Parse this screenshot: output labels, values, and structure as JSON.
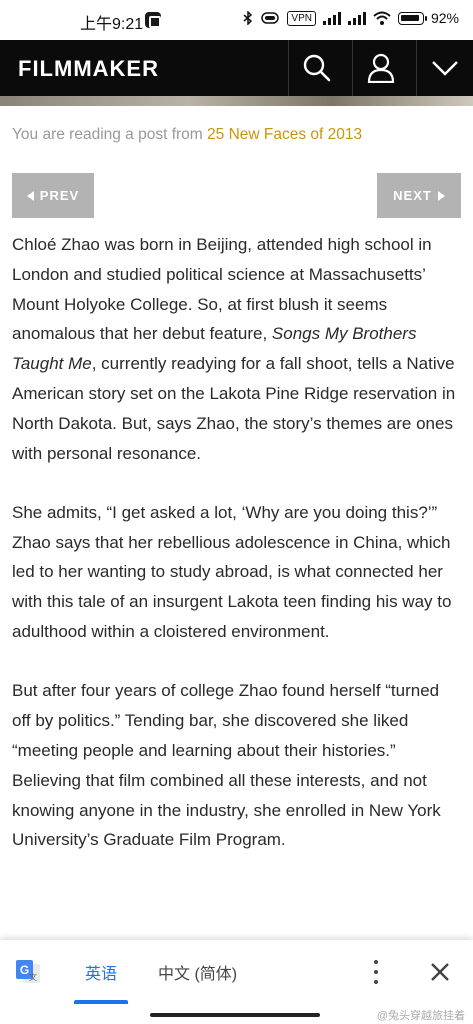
{
  "status_bar": {
    "time": "上午9:21",
    "vpn": "VPN",
    "battery": "92%"
  },
  "header": {
    "logo": "FILMMAKER",
    "icons": [
      "search-icon",
      "user-icon",
      "chevron-down-icon"
    ],
    "background": "#0b0b0b"
  },
  "breadcrumb": {
    "prefix": "You are reading a post from",
    "link": "25 New Faces of 2013",
    "link_color": "#c8950e"
  },
  "pagination": {
    "prev": "PREV",
    "next": "NEXT"
  },
  "article": {
    "p1_a": "Chloé Zhao was born in Beijing, attended high school in London and studied political science at Massachusetts’ Mount Holyoke College. So, at first blush it seems anomalous that her debut feature, ",
    "p1_title": "Songs My Brothers Taught Me",
    "p1_b": ", currently readying for a fall shoot, tells a Native American story set on the Lakota Pine Ridge reservation in North Dakota. But, says Zhao, the story’s themes are ones with personal resonance.",
    "p2": "She admits, “I get asked a lot, ‘Why are you doing this?’” Zhao says that her rebellious adolescence in China, which led to her wanting to study abroad, is what connected her with this tale of an insurgent Lakota teen finding his way to adulthood within a cloistered environment.",
    "p3": "But after four years of college Zhao found herself “turned off by politics.” Tending bar, she discovered she liked “meeting people and learning about their histories.” Believing that film combined all these interests, and not knowing anyone in the industry, she enrolled in New York University’s Graduate Film Program."
  },
  "translate_bar": {
    "lang_source": "英语",
    "lang_target": "中文 (简体)",
    "accent": "#1a73e8"
  },
  "watermark": "@兔头穿越旅挂着"
}
